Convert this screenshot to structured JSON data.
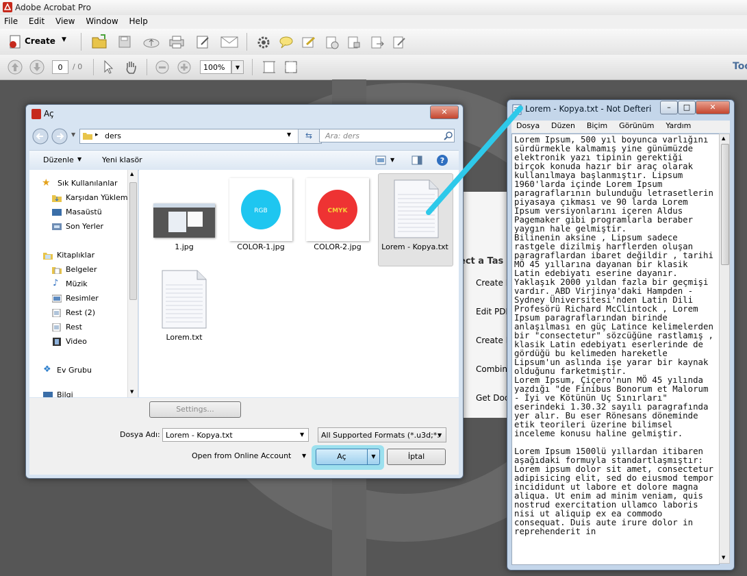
{
  "app": {
    "title": "Adobe Acrobat Pro"
  },
  "menu": [
    "File",
    "Edit",
    "View",
    "Window",
    "Help"
  ],
  "toolbar": {
    "create_label": "Create",
    "page_current": "0",
    "page_total": "/ 0",
    "zoom": "100%",
    "tools_label": "Too"
  },
  "task_panel": {
    "heading": "ect a Tas",
    "items": [
      "Create P",
      "Edit PDF",
      "Create F",
      "Combin",
      "Get Doc"
    ]
  },
  "dialog": {
    "title": "Aç",
    "address": "ders",
    "search_placeholder": "Ara: ders",
    "organize": "Düzenle",
    "new_folder": "Yeni klasör",
    "nav": {
      "favorites": "Sık Kullanılanlar",
      "items_fav": [
        "Karşıdan Yüklem",
        "Masaüstü",
        "Son Yerler"
      ],
      "libraries": "Kitaplıklar",
      "items_lib": [
        "Belgeler",
        "Müzik",
        "Resimler",
        "Rest (2)",
        "Rest",
        "Video"
      ],
      "homegroup": "Ev Grubu",
      "computer": "Bilgi"
    },
    "files": [
      {
        "name": "1.jpg"
      },
      {
        "name": "COLOR-1.jpg",
        "badge": "RGB",
        "color": "#1ec6f0"
      },
      {
        "name": "COLOR-2.jpg",
        "badge": "CMYK",
        "color": "#ee3333"
      },
      {
        "name": "Lorem - Kopya.txt"
      },
      {
        "name": "Lorem.txt"
      }
    ],
    "settings": "Settings...",
    "filename_label": "Dosya Adı:",
    "filename": "Lorem - Kopya.txt",
    "filetype": "All Supported Formats (*.u3d;*.",
    "online": "Open from Online Account",
    "open": "Aç",
    "cancel": "İptal"
  },
  "notepad": {
    "title": "Lorem - Kopya.txt - Not Defteri",
    "menu": [
      "Dosya",
      "Düzen",
      "Biçim",
      "Görünüm",
      "Yardım"
    ],
    "text": "Lorem Ipsum, 500 yıl boyunca varlığını sürdürmekle kalmamış yine günümüzde elektronik yazı tipinin gerektiği birçok konuda hazır bir araç olarak kullanılmaya başlanmıştır. Lipsum 1960'larda içinde Lorem Ipsum paragraflarının bulunduğu letrasetlerin piyasaya çıkması ve 90 larda Lorem Ipsum versiyonlarını içeren Aldus Pagemaker gibi programlarla beraber yaygın hale gelmiştir.\nBilinenin aksine , Lipsum sadece rastgele dizilmiş harflerden oluşan paragraflardan ibaret değildir , tarihi MÖ 45 yıllarına dayanan bir klasik Latin edebiyatı eserine dayanır. Yaklaşık 2000 yıldan fazla bir geçmişi vardır. ABD Virjinya'daki Hampden - Sydney Üniversitesi'nden Latin Dili Profesörü Richard McClintock , Lorem Ipsum paragraflarından birinde anlaşılması en güç Latince kelimelerden bir \"consectetur\" sözcüğüne rastlamış , klasik Latin edebiyatı eserlerinde de gördüğü bu kelimeden hareketle Lipsum'un aslında işe yarar bir kaynak olduğunu farketmiştir.\nLorem Ipsum, Çiçero'nun MÖ 45 yılında yazdığı \"de Finibus Bonorum et Malorum - İyi ve Kötünün Uç Sınırları\" eserindeki 1.30.32 sayılı paragrafında yer alır. Bu eser Rönesans döneminde etik teorileri üzerine bilimsel inceleme konusu haline gelmiştir.\n\nLorem Ipsum 1500lü yıllardan itibaren aşağıdaki formuyla standartlaşmıştır: Lorem ipsum dolor sit amet, consectetur adipisicing elit, sed do eiusmod tempor incididunt ut labore et dolore magna aliqua. Ut enim ad minim veniam, quis nostrud exercitation ullamco laboris nisi ut aliquip ex ea commodo consequat. Duis aute irure dolor in reprehenderit in"
  }
}
